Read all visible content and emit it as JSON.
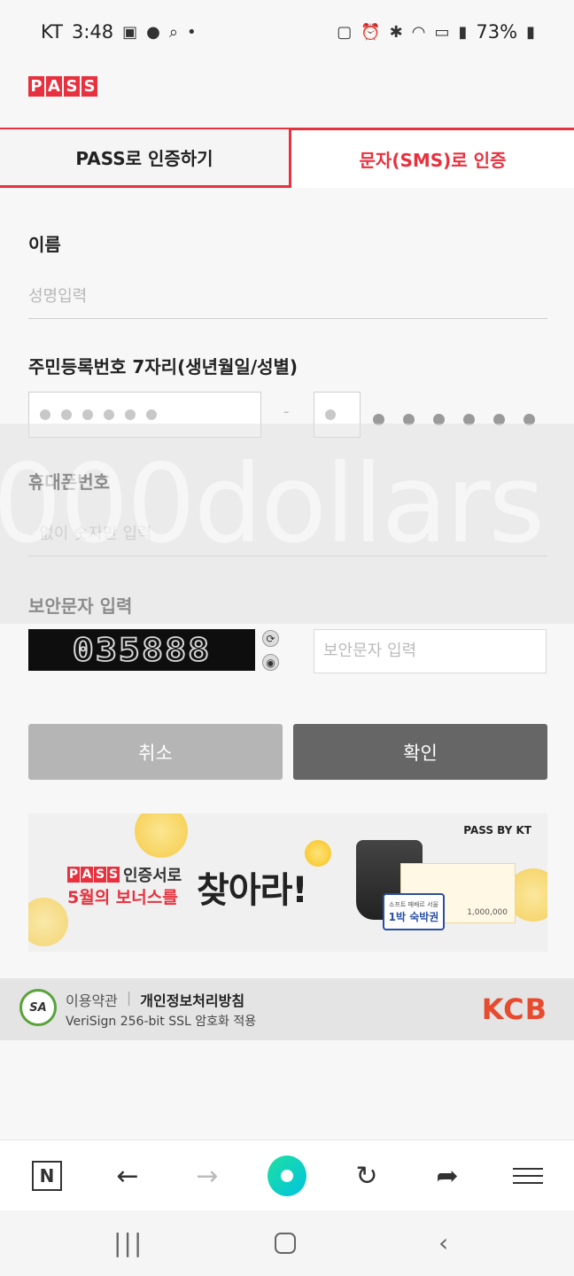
{
  "status_bar": {
    "carrier": "KT",
    "time": "3:48",
    "battery": "73%"
  },
  "logo": {
    "letters": [
      "P",
      "A",
      "S",
      "S"
    ]
  },
  "tabs": {
    "pass_auth": "PASS로 인증하기",
    "sms_auth": "문자(SMS)로 인증"
  },
  "form": {
    "name_label": "이름",
    "name_placeholder": "성명입력",
    "rrn_label": "주민등록번호 7자리(생년월일/성별)",
    "rrn_dash": "-",
    "phone_label": "휴대폰번호",
    "phone_placeholder": "- 없이 숫자만 입력",
    "captcha_label": "보안문자 입력",
    "captcha_code": "035888",
    "captcha_placeholder": "보안문자 입력"
  },
  "watermark": "000dollars",
  "buttons": {
    "cancel": "취소",
    "confirm": "확인"
  },
  "banner": {
    "brand": "PASS BY KT",
    "pass_letters": [
      "P",
      "A",
      "S",
      "S"
    ],
    "line1_suffix": "인증서로",
    "line2": "5월의 보너스를",
    "big_text": "찾아라!",
    "ticket_amount": "1,000,000",
    "tag_small": "소프트 패배르 서울",
    "tag_main": "1박 숙박권"
  },
  "footer": {
    "seal": "SA",
    "terms": "이용약관",
    "privacy": "개인정보처리방침",
    "ssl": "VeriSign 256-bit SSL 암호화 적용",
    "kcb": "KCB"
  },
  "colors": {
    "accent": "#e8313e",
    "confirm_button": "#666666",
    "cancel_button": "#b5b5b5"
  }
}
